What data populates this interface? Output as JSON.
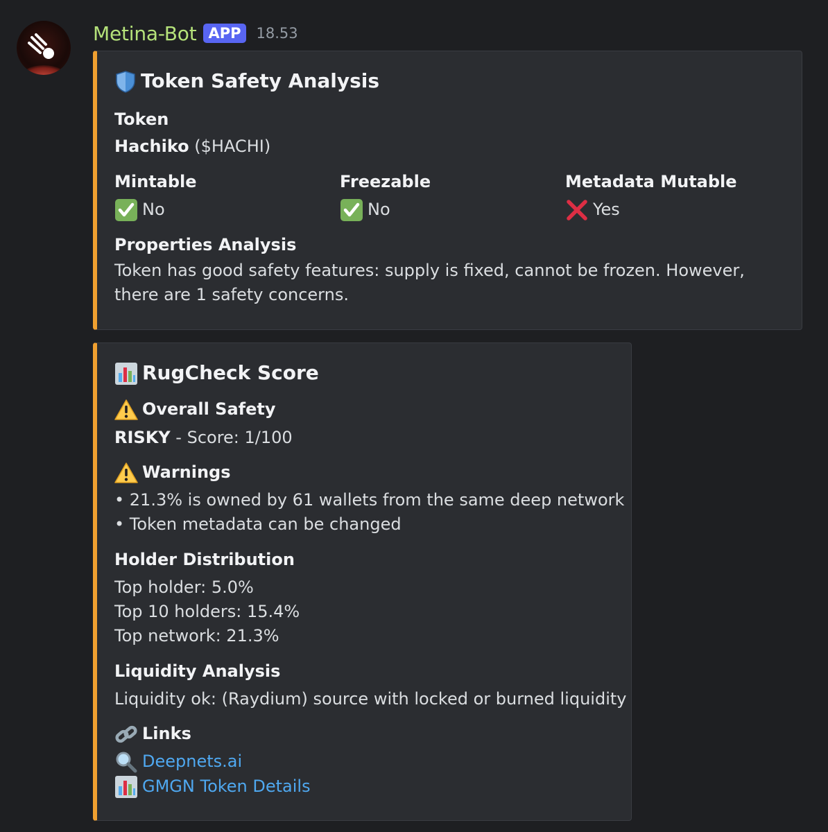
{
  "message": {
    "author": "Metina-Bot",
    "badge": "APP",
    "time": "18.53"
  },
  "embed1": {
    "title": "Token Safety Analysis",
    "token_label": "Token",
    "token_name": "Hachiko",
    "token_symbol": " ($HACHI)",
    "fields": [
      {
        "label": "Mintable",
        "value": "No",
        "icon": "check-mark-icon"
      },
      {
        "label": "Freezable",
        "value": "No",
        "icon": "check-mark-icon"
      },
      {
        "label": "Metadata Mutable",
        "value": "Yes",
        "icon": "cross-mark-icon"
      }
    ],
    "properties_label": "Properties Analysis",
    "properties_text": "Token has good safety features: supply is fixed, cannot be frozen. However, there are 1 safety concerns."
  },
  "embed2": {
    "title": "RugCheck Score",
    "overall_label": "Overall Safety",
    "overall_status": "RISKY",
    "overall_score": " - Score: 1/100",
    "warnings_label": "Warnings",
    "warnings": [
      "• 21.3% is owned by 61 wallets from the same deep network",
      "• Token metadata can be changed"
    ],
    "holder_label": "Holder Distribution",
    "holder_lines": [
      "Top holder: 5.0%",
      "Top 10 holders: 15.4%",
      "Top network: 21.3%"
    ],
    "liquidity_label": "Liquidity Analysis",
    "liquidity_text": "Liquidity ok: (Raydium) source with locked or burned liquidity",
    "links_label": "Links",
    "links": [
      {
        "label": "Deepnets.ai",
        "icon": "magnifier-icon"
      },
      {
        "label": "GMGN Token Details",
        "icon": "bar-chart-icon"
      }
    ]
  },
  "colors": {
    "background": "#1e1f22",
    "embed_bg": "#2b2d31",
    "accent_border": "#f0a030",
    "author": "#b5e27a",
    "badge": "#5865f2",
    "link": "#4fa8f0"
  }
}
